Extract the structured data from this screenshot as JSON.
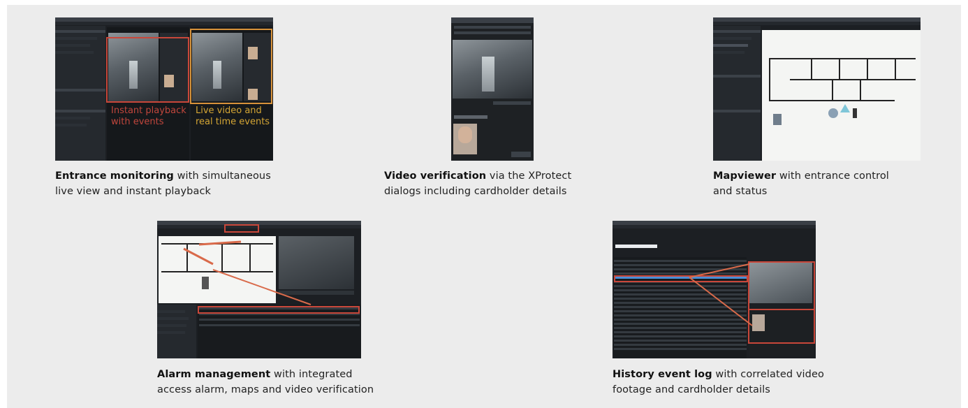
{
  "items": [
    {
      "id": "entrance",
      "bold": "Entrance monitoring",
      "text": " with simultaneous live view and instant playback",
      "line1_bold": "Entrance monitoring",
      "line1_rest": " with simultaneous",
      "line2": "live view and instant playback",
      "overlay_left": "Instant playback\nwith events",
      "overlay_right": "Live video and\nreal time events"
    },
    {
      "id": "verification",
      "line1_bold": "Video verification",
      "line1_rest": " via the XProtect",
      "line2": "dialogs including cardholder details"
    },
    {
      "id": "mapviewer",
      "line1_bold": "Mapviewer",
      "line1_rest": " with entrance control",
      "line2": "and status"
    },
    {
      "id": "alarm",
      "line1_bold": "Alarm management",
      "line1_rest": " with integrated",
      "line2": "access alarm, maps and video verification"
    },
    {
      "id": "history",
      "line1_bold": "History event log",
      "line1_rest": " with correlated video",
      "line2": "footage and cardholder details"
    }
  ],
  "overlay": {
    "entrance_left_1": "Instant playback",
    "entrance_left_2": "with events",
    "entrance_right_1": "Live video and",
    "entrance_right_2": "real time events",
    "left_color": "#c0463c",
    "right_color": "#d4a534"
  }
}
